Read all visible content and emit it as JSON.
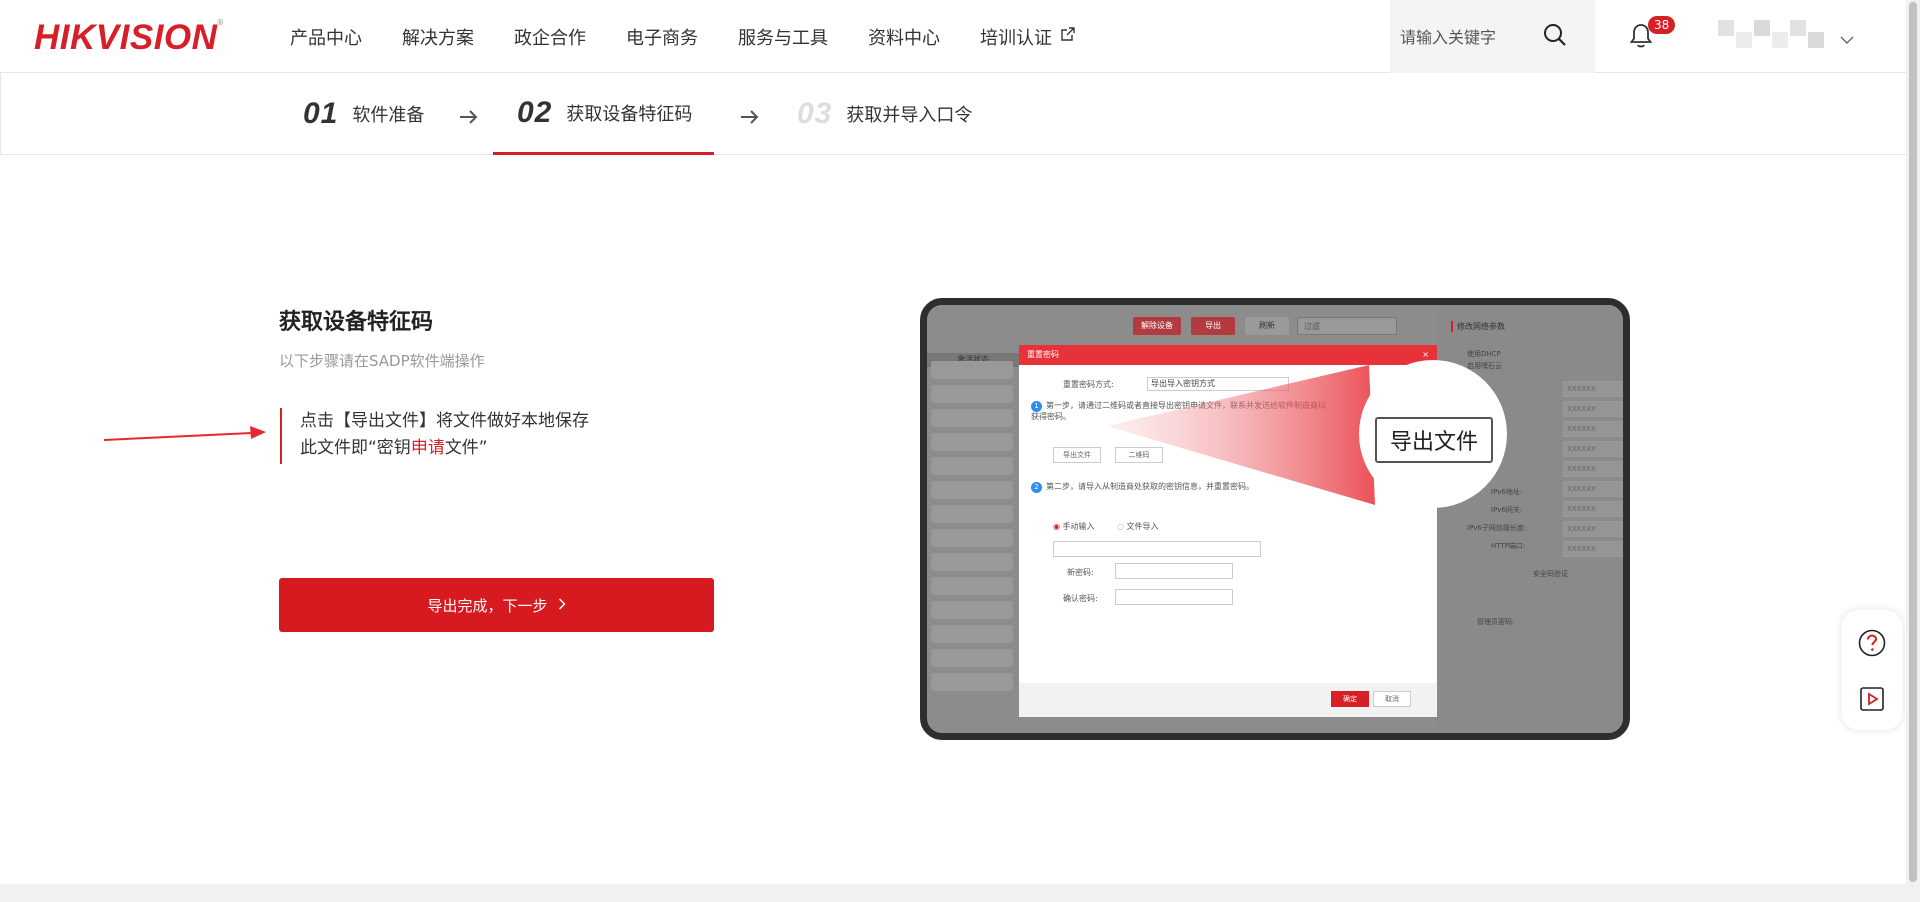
{
  "header": {
    "logo": "HIKVISION",
    "nav": [
      "产品中心",
      "解决方案",
      "政企合作",
      "电子商务",
      "服务与工具",
      "资料中心",
      "培训认证"
    ],
    "search_placeholder": "请输入关键字",
    "notification_count": "38"
  },
  "steps": [
    {
      "num": "01",
      "label": "软件准备",
      "state": "done"
    },
    {
      "num": "02",
      "label": "获取设备特征码",
      "state": "active"
    },
    {
      "num": "03",
      "label": "获取并导入口令",
      "state": "future"
    }
  ],
  "main": {
    "title": "获取设备特征码",
    "subtitle": "以下步骤请在SADP软件端操作",
    "instruction_line1": "点击【导出文件】将文件做好本地保存",
    "instruction_line2_a": "此文件即“密钥",
    "instruction_line2_b": "申请",
    "instruction_line2_c": "文件”",
    "next_button": "导出完成，下一步"
  },
  "illustration": {
    "toolbar": [
      "解除设备",
      "导出",
      "刷新"
    ],
    "filter_placeholder": "过滤",
    "column_header": "激活状态",
    "right_panel_title": "修改网络参数",
    "right_panel_checks": [
      "使用DHCP",
      "启用嘿石云"
    ],
    "right_panel_fields": [
      {
        "label": "端口号:",
        "value": "XXXXXX"
      },
      {
        "label": "IPv4地址:",
        "value": "XXXXXX"
      },
      {
        "label": "子网掩码:",
        "value": "XXXXXX"
      },
      {
        "label": "网关:",
        "value": "XXXXXX"
      },
      {
        "label": "IPv6地址:",
        "value": "XXXXXX"
      },
      {
        "label": "IPv6网关:",
        "value": "XXXXXX"
      },
      {
        "label": "IPv6子网前缀长度:",
        "value": "XXXXXX"
      },
      {
        "label": "HTTP端口:",
        "value": "XXXXXX"
      },
      {
        "label": "HTTP端口:",
        "value": "XXXXXX"
      }
    ],
    "right_panel_section": "安全码验证",
    "right_panel_admin": "管理员密码:",
    "dialog_title": "重置密码",
    "dialog_mode_label": "重置密码方式:",
    "dialog_mode_value": "导出导入密钥方式",
    "dialog_step1": "第一步，请通过二维码或者直接导出密钥申请文件，联系并发送给软件制造商以获得密码。",
    "dialog_export_btn": "导出文件",
    "dialog_qr_btn": "二维码",
    "dialog_step2": "第二步，请导入从制造商处获取的密钥信息，并重置密码。",
    "dialog_radio_manual": "手动输入",
    "dialog_radio_file": "文件导入",
    "dialog_new_pwd": "新密码:",
    "dialog_confirm_pwd": "确认密码:",
    "dialog_ok": "确定",
    "dialog_cancel": "取消",
    "zoom_label": "导出文件"
  },
  "colors": {
    "brand_red": "#d61f26",
    "button_red": "#d71920"
  }
}
